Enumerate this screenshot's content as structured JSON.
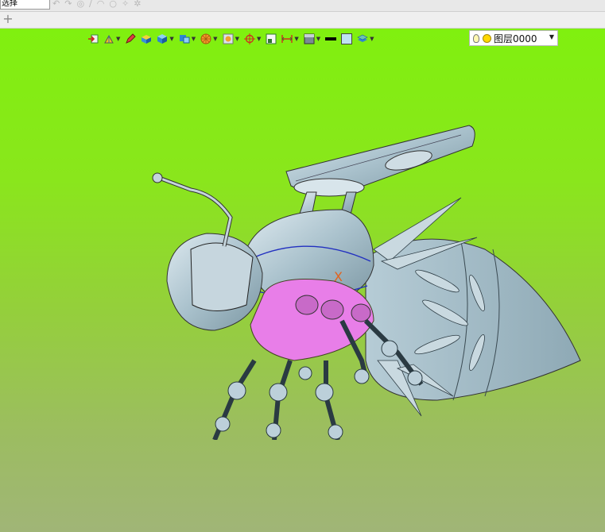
{
  "top_toolbar": {
    "selection_filter_value": "选择"
  },
  "tab_bar": {
    "new_tab_label": "+"
  },
  "view_toolbar": {
    "tools": [
      {
        "icon": "exit-sketch-icon"
      },
      {
        "icon": "view-orientation-icon"
      },
      {
        "icon": "pencil-icon"
      },
      {
        "icon": "shaded-solid-icon"
      },
      {
        "icon": "cube-icon"
      },
      {
        "icon": "section-view-icon"
      },
      {
        "icon": "render-style-icon"
      },
      {
        "icon": "display-filter-icon"
      },
      {
        "icon": "snap-target-icon"
      },
      {
        "icon": "frame-icon"
      },
      {
        "icon": "dimension-icon"
      },
      {
        "icon": "background-icon"
      },
      {
        "icon": "line-color-icon"
      },
      {
        "icon": "fill-color-icon"
      },
      {
        "icon": "layers-icon"
      }
    ],
    "layer_selector": {
      "value": "图层0000"
    },
    "colors": {
      "line_swatch": "#000000",
      "fill_swatch": "#bfe3f3",
      "viewport_top": "#80f00f",
      "viewport_bottom": "#a0b577",
      "model_body": "#b8cfda",
      "model_highlight": "#e87ee8"
    }
  },
  "viewport": {
    "axis_marker_label": "X"
  }
}
